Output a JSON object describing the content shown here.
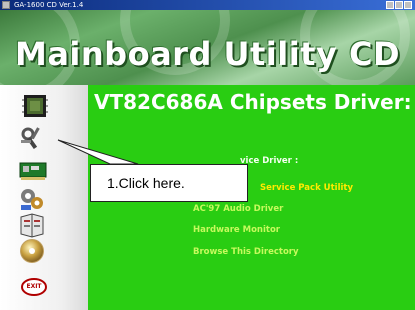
{
  "window": {
    "title": "GA-1600 CD Ver.1.4"
  },
  "banner": {
    "title": "Mainboard Utility CD"
  },
  "main": {
    "headline": "VT82C686A Chipsets Driver:",
    "items": [
      "vice Driver :",
      "Service Pack Utility",
      "AC'97 Audio Driver",
      "Hardware Monitor",
      "Browse This Directory"
    ]
  },
  "sidebar": {
    "icons": [
      "chip-icon",
      "tools-icon",
      "card-icon",
      "gears-icon",
      "book-icon",
      "cd-icon",
      "exit-icon"
    ],
    "exit_label": "EXIT"
  },
  "callout": {
    "text": "1.Click here."
  },
  "colors": {
    "main_bg": "#29cd12",
    "link_yellow": "#ffea00",
    "banner_green": "#4e904e",
    "titlebar_blue": "#0a2a7a"
  }
}
